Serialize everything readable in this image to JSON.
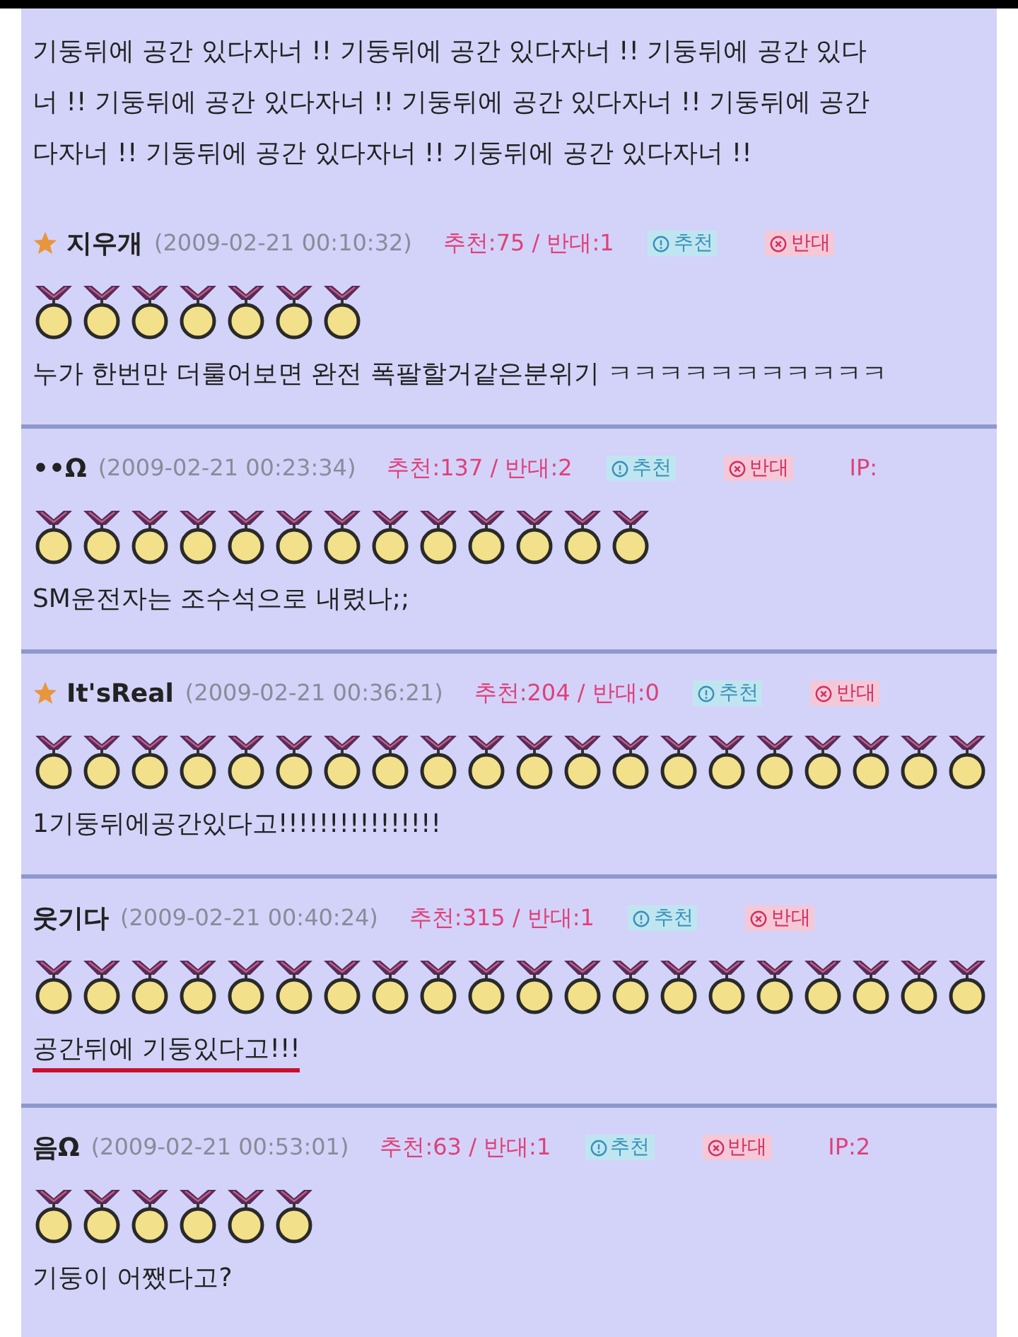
{
  "previous_comment": {
    "lines": [
      "기둥뒤에 공간 있다자너 !! 기둥뒤에 공간 있다자너 !! 기둥뒤에 공간 있다",
      "너 !! 기둥뒤에 공간 있다자너 !! 기둥뒤에 공간 있다자너 !! 기둥뒤에 공간",
      "다자너 !! 기둥뒤에 공간 있다자너 !! 기둥뒤에 공간 있다자너 !!"
    ]
  },
  "comments": [
    {
      "starred": true,
      "author": "지우개",
      "date": "(2009-02-21 00:10:32)",
      "votes": "추천:75 / 반대:1",
      "up_button": "추천",
      "down_button": "반대",
      "badges": [
        {
          "kind": "medal"
        },
        {
          "kind": "medal"
        },
        {
          "kind": "medal"
        },
        {
          "kind": "medal"
        },
        {
          "kind": "medal"
        },
        {
          "kind": "medal"
        },
        {
          "kind": "medal"
        }
      ],
      "text": "누가 한번만 더룰어보면 완전 폭팔할거같은분위기 ㅋㅋㅋㅋㅋㅋㅋㅋㅋㅋㅋ",
      "underlined": false
    },
    {
      "starred": false,
      "author": "••Ω",
      "date": "(2009-02-21 00:23:34)",
      "votes": "추천:137 / 반대:2",
      "up_button": "추천",
      "down_button": "반대",
      "ip": "IP:",
      "badges": [
        {
          "kind": "medal"
        },
        {
          "kind": "medal"
        },
        {
          "kind": "medal"
        },
        {
          "kind": "medal"
        },
        {
          "kind": "medal"
        },
        {
          "kind": "medal"
        },
        {
          "kind": "medal"
        },
        {
          "kind": "medal"
        },
        {
          "kind": "medal"
        },
        {
          "kind": "medal"
        },
        {
          "kind": "medal"
        },
        {
          "kind": "medal"
        },
        {
          "kind": "medal"
        }
      ],
      "text": "SM운전자는 조수석으로 내렸나;;",
      "underlined": false
    },
    {
      "starred": true,
      "author": "It'sReal",
      "date": "(2009-02-21 00:36:21)",
      "votes": "추천:204 / 반대:0",
      "up_button": "추천",
      "down_button": "반대",
      "badges": [
        {
          "kind": "medal"
        },
        {
          "kind": "medal"
        },
        {
          "kind": "medal"
        },
        {
          "kind": "medal"
        },
        {
          "kind": "medal"
        },
        {
          "kind": "medal"
        },
        {
          "kind": "medal"
        },
        {
          "kind": "medal"
        },
        {
          "kind": "medal"
        },
        {
          "kind": "medal"
        },
        {
          "kind": "medal"
        },
        {
          "kind": "medal"
        },
        {
          "kind": "medal"
        },
        {
          "kind": "medal"
        },
        {
          "kind": "medal"
        },
        {
          "kind": "medal"
        },
        {
          "kind": "medal"
        },
        {
          "kind": "medal"
        },
        {
          "kind": "medal"
        },
        {
          "kind": "medal"
        }
      ],
      "text": "1기둥뒤에공간있다고!!!!!!!!!!!!!!!!",
      "underlined": false
    },
    {
      "starred": false,
      "author": "웃기다",
      "date": "(2009-02-21 00:40:24)",
      "votes": "추천:315 / 반대:1",
      "up_button": "추천",
      "down_button": "반대",
      "badges": [
        {
          "kind": "medal"
        },
        {
          "kind": "medal"
        },
        {
          "kind": "medal"
        },
        {
          "kind": "medal"
        },
        {
          "kind": "medal"
        },
        {
          "kind": "medal"
        },
        {
          "kind": "medal"
        },
        {
          "kind": "medal"
        },
        {
          "kind": "medal"
        },
        {
          "kind": "medal"
        },
        {
          "kind": "medal"
        },
        {
          "kind": "medal"
        },
        {
          "kind": "medal"
        },
        {
          "kind": "medal"
        },
        {
          "kind": "medal"
        },
        {
          "kind": "medal"
        },
        {
          "kind": "medal"
        },
        {
          "kind": "medal"
        },
        {
          "kind": "medal"
        },
        {
          "kind": "medal"
        }
      ],
      "text": "공간뒤에 기둥있다고!!!",
      "underlined": true
    },
    {
      "starred": false,
      "author": "음Ω",
      "date": "(2009-02-21 00:53:01)",
      "votes": "추천:63 / 반대:1",
      "up_button": "추천",
      "down_button": "반대",
      "ip": "IP:2",
      "badges": [
        {
          "kind": "medal"
        },
        {
          "kind": "medal"
        },
        {
          "kind": "medal"
        },
        {
          "kind": "medal"
        },
        {
          "kind": "medal"
        },
        {
          "kind": "medal"
        }
      ],
      "text": "기둥이 어쨌다고?",
      "underlined": false
    }
  ]
}
